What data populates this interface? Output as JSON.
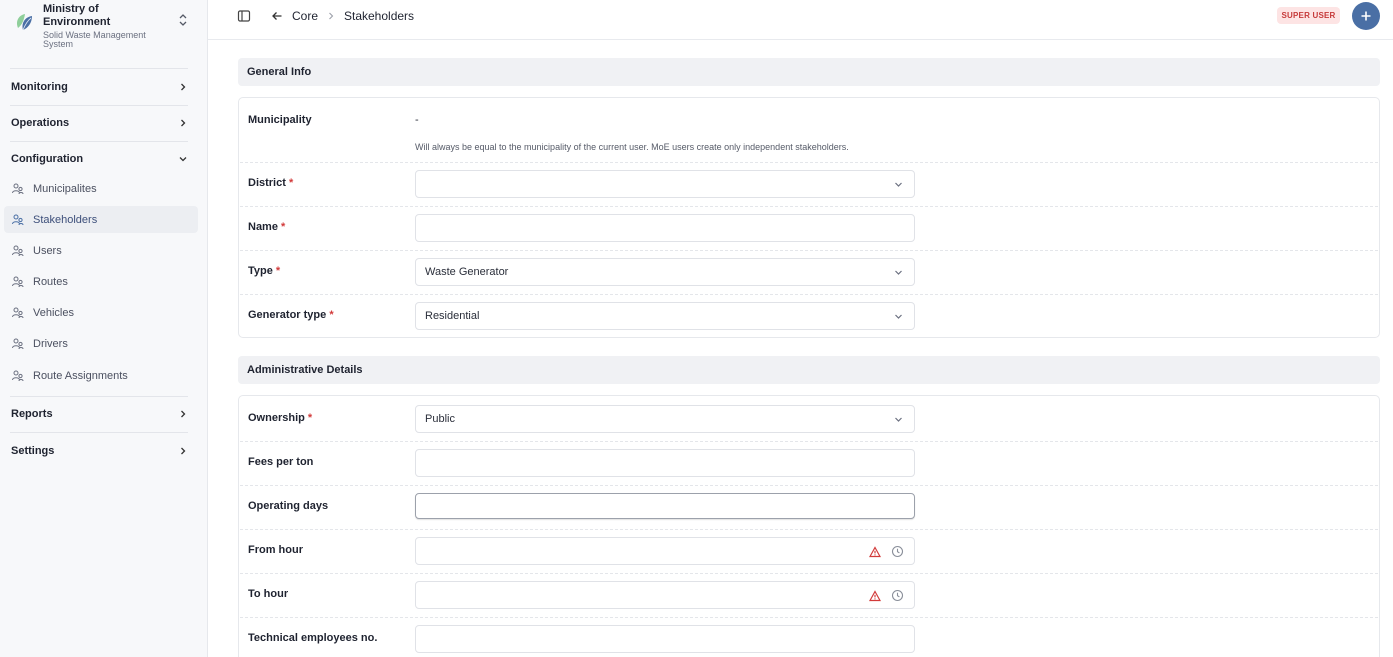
{
  "brand": {
    "title": "Ministry of Environment",
    "subtitle_line1": "Solid Waste Management",
    "subtitle_line2": "System"
  },
  "sidebar": {
    "groups": [
      {
        "label": "Monitoring"
      },
      {
        "label": "Operations"
      },
      {
        "label": "Configuration"
      },
      {
        "label": "Reports"
      },
      {
        "label": "Settings"
      }
    ],
    "config_items": [
      {
        "label": "Municipalites"
      },
      {
        "label": "Stakeholders"
      },
      {
        "label": "Users"
      },
      {
        "label": "Routes"
      },
      {
        "label": "Vehicles"
      },
      {
        "label": "Drivers"
      },
      {
        "label": "Route Assignments"
      }
    ],
    "active_item": "Stakeholders"
  },
  "topbar": {
    "breadcrumb": [
      "Core",
      "Stakeholders"
    ],
    "role_badge": "SUPER USER"
  },
  "general_info": {
    "section_title": "General Info",
    "municipality_label": "Municipality",
    "municipality_value": "-",
    "municipality_hint": "Will always be equal to the municipality of the current user. MoE users create only independent stakeholders.",
    "district_label": "District",
    "district_value": "",
    "name_label": "Name",
    "name_value": "",
    "type_label": "Type",
    "type_value": "Waste Generator",
    "generator_type_label": "Generator type",
    "generator_type_value": "Residential",
    "required_mark": "*"
  },
  "admin_details": {
    "section_title": "Administrative Details",
    "ownership_label": "Ownership",
    "ownership_value": "Public",
    "fees_label": "Fees per ton",
    "fees_value": "",
    "operating_days_label": "Operating days",
    "operating_days_value": "",
    "from_hour_label": "From hour",
    "from_hour_value": "",
    "to_hour_label": "To hour",
    "to_hour_value": "",
    "tech_employees_label": "Technical employees no.",
    "tech_employees_value": ""
  },
  "colors": {
    "accent": "#4a6fa5",
    "badge_bg": "#fde4e4",
    "badge_text": "#c63a3a",
    "required": "#d23a3a",
    "warning": "#d23a3a"
  },
  "icons": {
    "brand": "leaf-logo-icon",
    "switcher": "chevron-up-down-icon",
    "nav_item": "users-group-icon",
    "panel_toggle": "sidebar-panel-icon",
    "back": "arrow-left-icon",
    "add": "plus-icon",
    "select": "chevron-down-icon",
    "warning": "warning-triangle-icon",
    "clock": "clock-icon"
  }
}
